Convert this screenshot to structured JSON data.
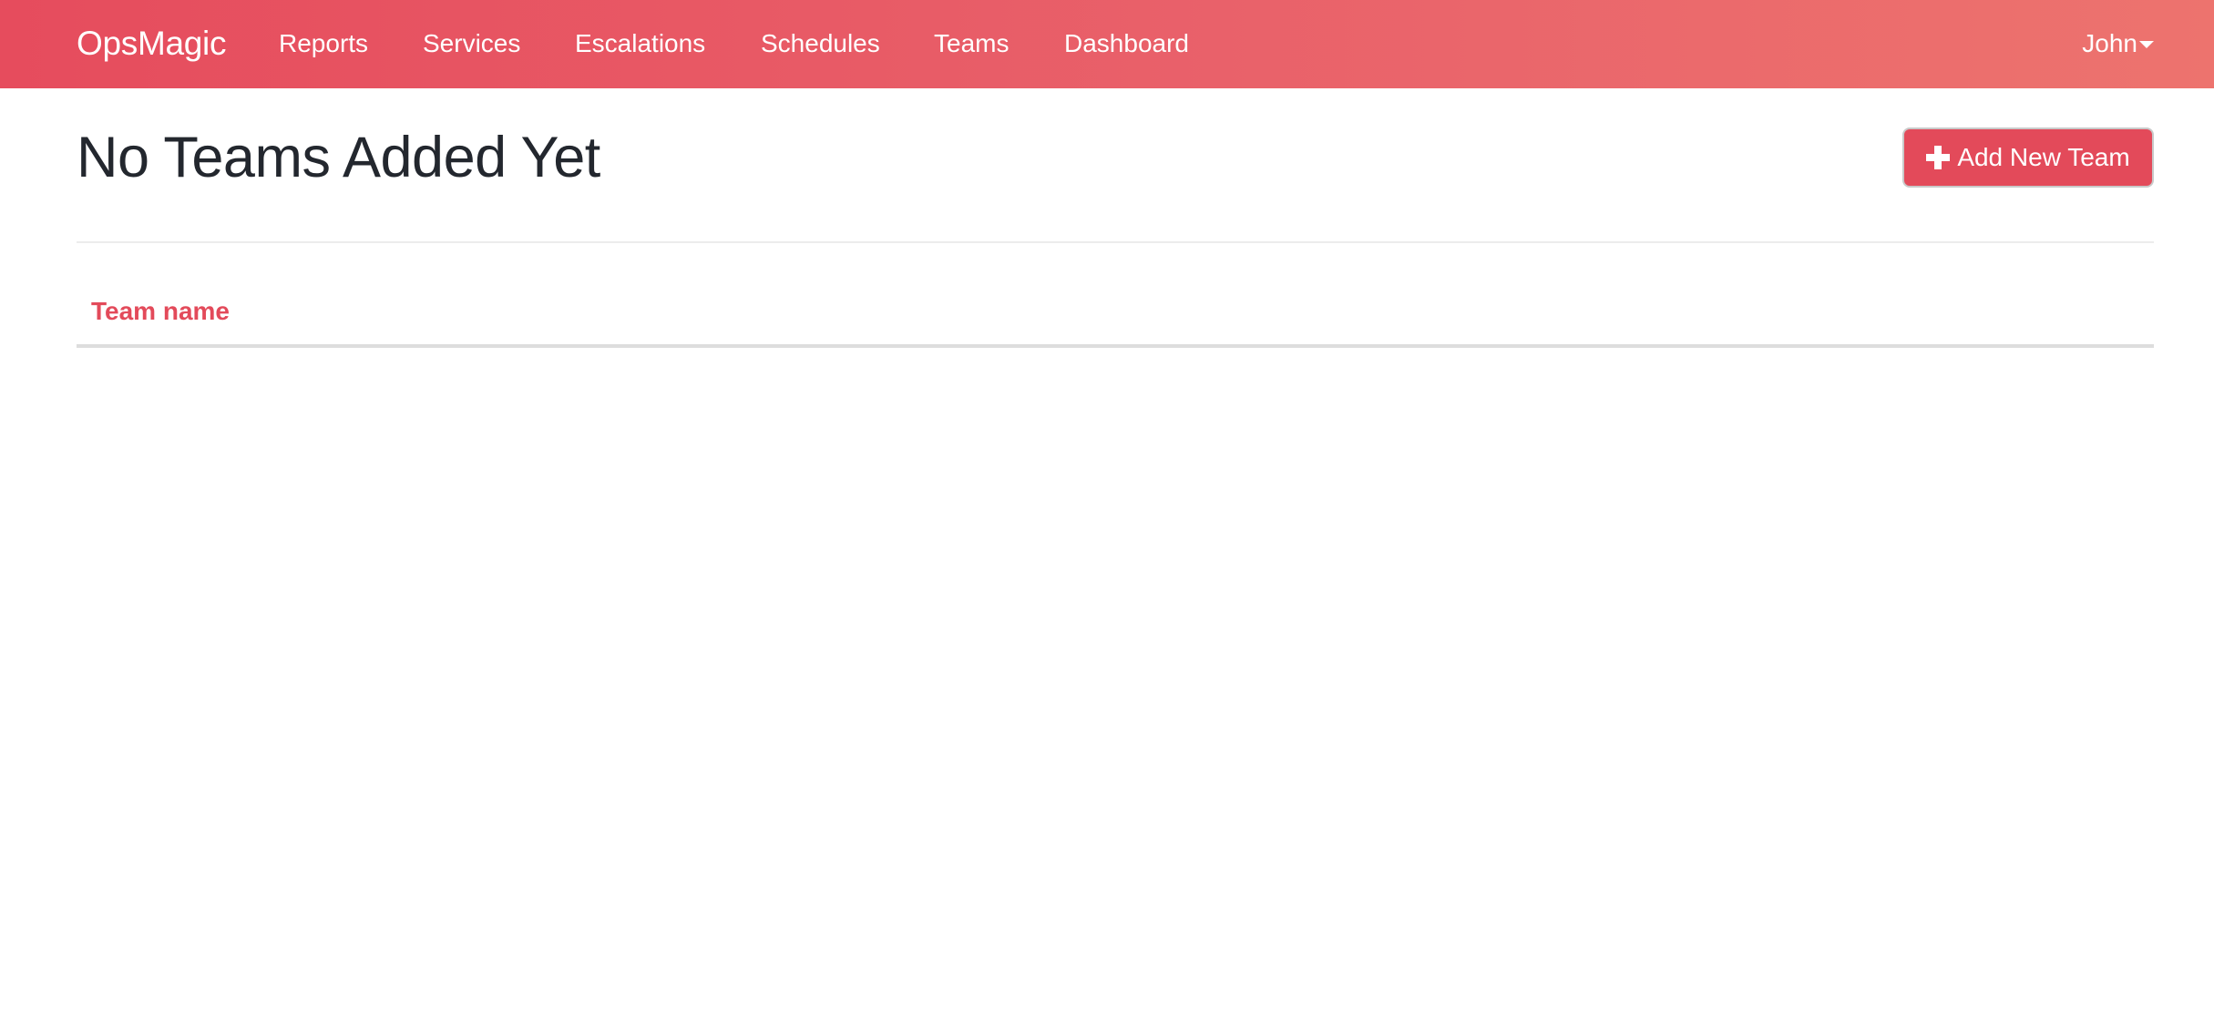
{
  "navbar": {
    "brand": "OpsMagic",
    "links": [
      {
        "label": "Reports"
      },
      {
        "label": "Services"
      },
      {
        "label": "Escalations"
      },
      {
        "label": "Schedules"
      },
      {
        "label": "Teams"
      },
      {
        "label": "Dashboard"
      }
    ],
    "user": {
      "name": "John",
      "icon": "caret-down-icon"
    }
  },
  "main": {
    "title": "No Teams Added Yet",
    "add_button": {
      "label": "Add New Team",
      "icon": "plus-icon"
    },
    "table": {
      "columns": [
        "Team name"
      ],
      "rows": []
    }
  },
  "colors": {
    "accent": "#e34a5a",
    "navbar_start": "#e64c5d",
    "navbar_end": "#ed736e",
    "title_text": "#23272e"
  }
}
